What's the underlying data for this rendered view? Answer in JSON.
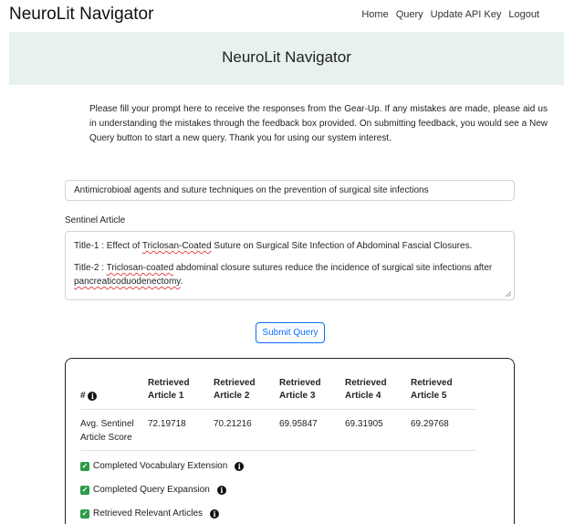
{
  "navbar": {
    "brand": "NeuroLit Navigator",
    "links": [
      "Home",
      "Query",
      "Update API Key",
      "Logout"
    ]
  },
  "hero": {
    "title": "NeuroLit Navigator"
  },
  "intro": {
    "text": "Please fill your prompt here to receive the responses from the Gear-Up. If any mistakes are made, please aid us in understanding the mistakes through the feedback box provided. On submitting feedback, you would see a New Query button to start a new query. Thank you for using our system interest."
  },
  "query": {
    "value": "Antimicrobioal agents and suture techniques on the prevention of surgical site infections"
  },
  "sentinel": {
    "label": "Sentinel Article",
    "title1_prefix": "Title-1 : Effect of ",
    "title1_spell": "Triclosan-Coated",
    "title1_rest": " Suture on Surgical Site Infection of Abdominal Fascial Closures.",
    "title2_prefix": "Title-2 : ",
    "title2_spell": "Triclosan-coated",
    "title2_rest": " abdominal closure sutures reduce the incidence of surgical site infections after",
    "title2_spell2": "pancreaticoduodenectomy",
    "title2_end": "."
  },
  "submit": {
    "label": "Submit Query"
  },
  "results": {
    "hash_header": "#",
    "info_glyph": "i",
    "headers": [
      [
        "Retrieved",
        "Article 1"
      ],
      [
        "Retrieved",
        "Article 2"
      ],
      [
        "Retrieved",
        "Article 3"
      ],
      [
        "Retrieved",
        "Article 4"
      ],
      [
        "Retrieved",
        "Article 5"
      ]
    ],
    "row_label": [
      "Avg. Sentinel",
      "Article Score"
    ],
    "scores": [
      "72.19718",
      "70.21216",
      "69.95847",
      "69.31905",
      "69.29768"
    ]
  },
  "status": {
    "check_glyph": "✓",
    "items": [
      "Completed Vocabulary Extension",
      "Completed Query Expansion",
      "Retrieved Relevant Articles"
    ]
  },
  "colors": {
    "accent": "#0d6efd",
    "hero_bg": "#e7f1ef",
    "check": "#2e9b4a"
  }
}
